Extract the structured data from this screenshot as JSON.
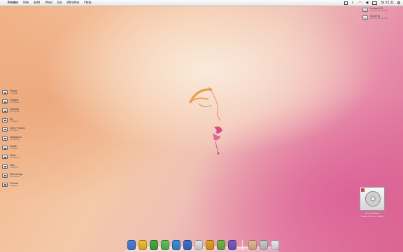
{
  "menubar": {
    "apple": "",
    "items": [
      "Finder",
      "File",
      "Edit",
      "View",
      "Go",
      "Window",
      "Help"
    ],
    "clock": "Sr 21:11"
  },
  "drives": [
    {
      "name": "Leopard HD",
      "info": "30,6 GB frei, 53 GB"
    },
    {
      "name": "Snow HD",
      "info": "58,5 GB frei, 91 GB"
    }
  ],
  "folders": [
    {
      "name": "iPhone",
      "info": "4 Objekte"
    },
    {
      "name": "Projekte",
      "info": "12 Objekte"
    },
    {
      "name": "Software",
      "info": "23 Objekte"
    },
    {
      "name": "Art",
      "info": "9 Objekte"
    },
    {
      "name": "Icons + Docks",
      "info": "6 Objekte"
    },
    {
      "name": "Wallpapers",
      "info": "31 Objekte"
    },
    {
      "name": "Mobile",
      "info": "7 Objekte"
    },
    {
      "name": "Music",
      "info": "18 Objekte"
    },
    {
      "name": "Web",
      "info": "5 Objekte"
    },
    {
      "name": "Web Design",
      "info": "14 Objekte"
    },
    {
      "name": "Themes",
      "info": "8 Objekte"
    }
  ],
  "itunes": {
    "title": "Paint It Black",
    "artist": "Heather McKee - Bigwa"
  },
  "dock": {
    "icons": [
      {
        "name": "finder-icon",
        "color": "#4d7fd6"
      },
      {
        "name": "notes-icon",
        "color": "#f0c030"
      },
      {
        "name": "adium-icon",
        "color": "#48a84a"
      },
      {
        "name": "messages-icon",
        "color": "#5cc05c"
      },
      {
        "name": "safari-icon",
        "color": "#3d8fd8"
      },
      {
        "name": "itunes-icon",
        "color": "#3b6fc7"
      },
      {
        "name": "calendar-icon",
        "color": "#e2e2e2"
      },
      {
        "name": "transmit-icon",
        "color": "#e8a020"
      },
      {
        "name": "twitter-icon",
        "color": "#6fb44a"
      },
      {
        "name": "system-preferences-icon",
        "color": "#7e5bc0"
      }
    ],
    "stacks": [
      {
        "name": "applications-stack-icon",
        "color": "#e2b98f"
      },
      {
        "name": "documents-stack-icon",
        "color": "#c9c9c9"
      },
      {
        "name": "trash-icon",
        "color": "#e8e8e8"
      }
    ]
  }
}
